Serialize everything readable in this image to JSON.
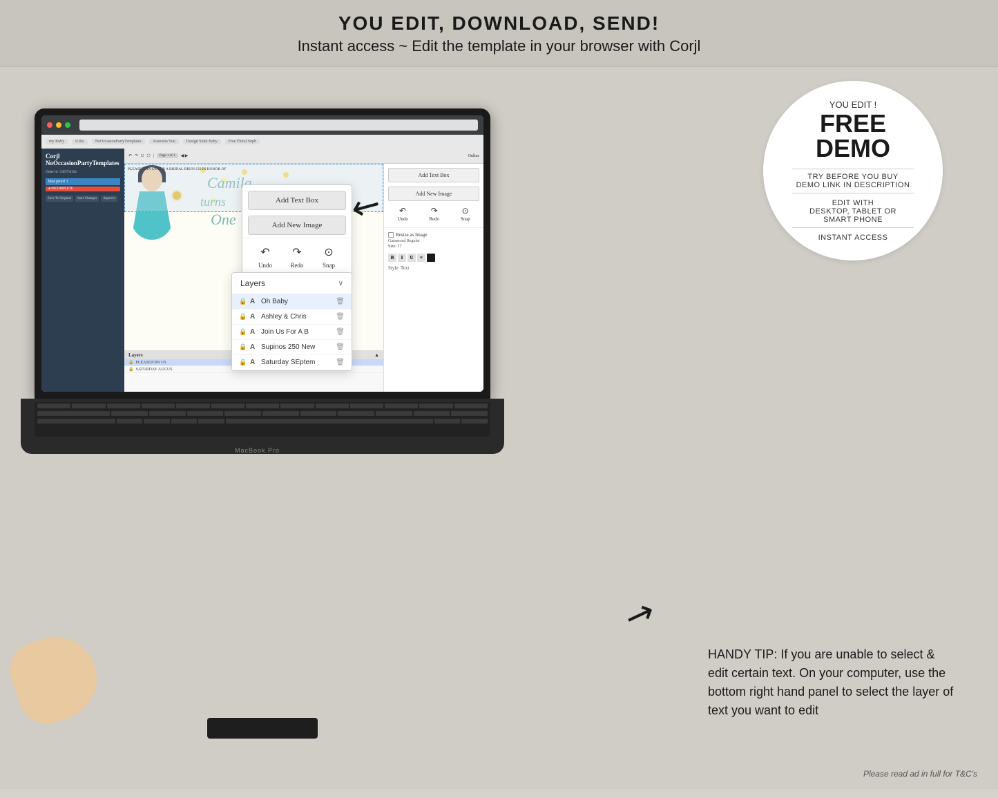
{
  "header": {
    "title": "YOU EDIT, DOWNLOAD, SEND!",
    "subtitle": "Instant access ~ Edit the template in your browser with Corjl"
  },
  "free_demo": {
    "you_edit": "YOU EDIT !",
    "free": "FREE",
    "demo": "DEMO",
    "try_before": "TRY BEFORE YOU BUY",
    "demo_link": "DEMO LINK IN DESCRIPTION",
    "edit_with": "EDIT WITH",
    "devices": "DESKTOP, TABLET OR",
    "phone": "SMART PHONE",
    "instant": "INSTANT ACCESS"
  },
  "corjl_panel": {
    "add_text_box": "Add Text Box",
    "add_new_image": "Add New Image",
    "undo": "Undo",
    "redo": "Redo",
    "snap": "Snap"
  },
  "layers": {
    "header": "Layers",
    "items": [
      {
        "lock": "🔒",
        "type": "A",
        "name": "Oh Baby",
        "selected": true
      },
      {
        "lock": "🔒",
        "type": "A",
        "name": "Ashley & Chris",
        "selected": false
      },
      {
        "lock": "🔒",
        "type": "A",
        "name": "Join Us For A B",
        "selected": false
      },
      {
        "lock": "🔒",
        "type": "A",
        "name": "Supinos 250 New",
        "selected": false
      },
      {
        "lock": "🔒",
        "type": "A",
        "name": "Saturday SEptem",
        "selected": false
      }
    ]
  },
  "handy_tip": {
    "text": "HANDY TIP: If you are unable to select & edit certain text. On your computer, use the bottom right hand panel to select the layer of text you want to edit"
  },
  "canvas": {
    "camila": "Camila",
    "turns": "turns",
    "one": "One"
  },
  "bridal_text": "PLEASE JOIN US FOR A BRIDAL BRUN CH IN HONOR OF",
  "laptop_layers": {
    "header": "Layers",
    "items": [
      {
        "name": "PLEASEJOIN US",
        "selected": true
      },
      {
        "name": "SATURDAY AUGUS",
        "selected": false
      }
    ]
  },
  "tc_note": "Please read ad in full for T&C's",
  "macbook_label": "MacBook Pro"
}
